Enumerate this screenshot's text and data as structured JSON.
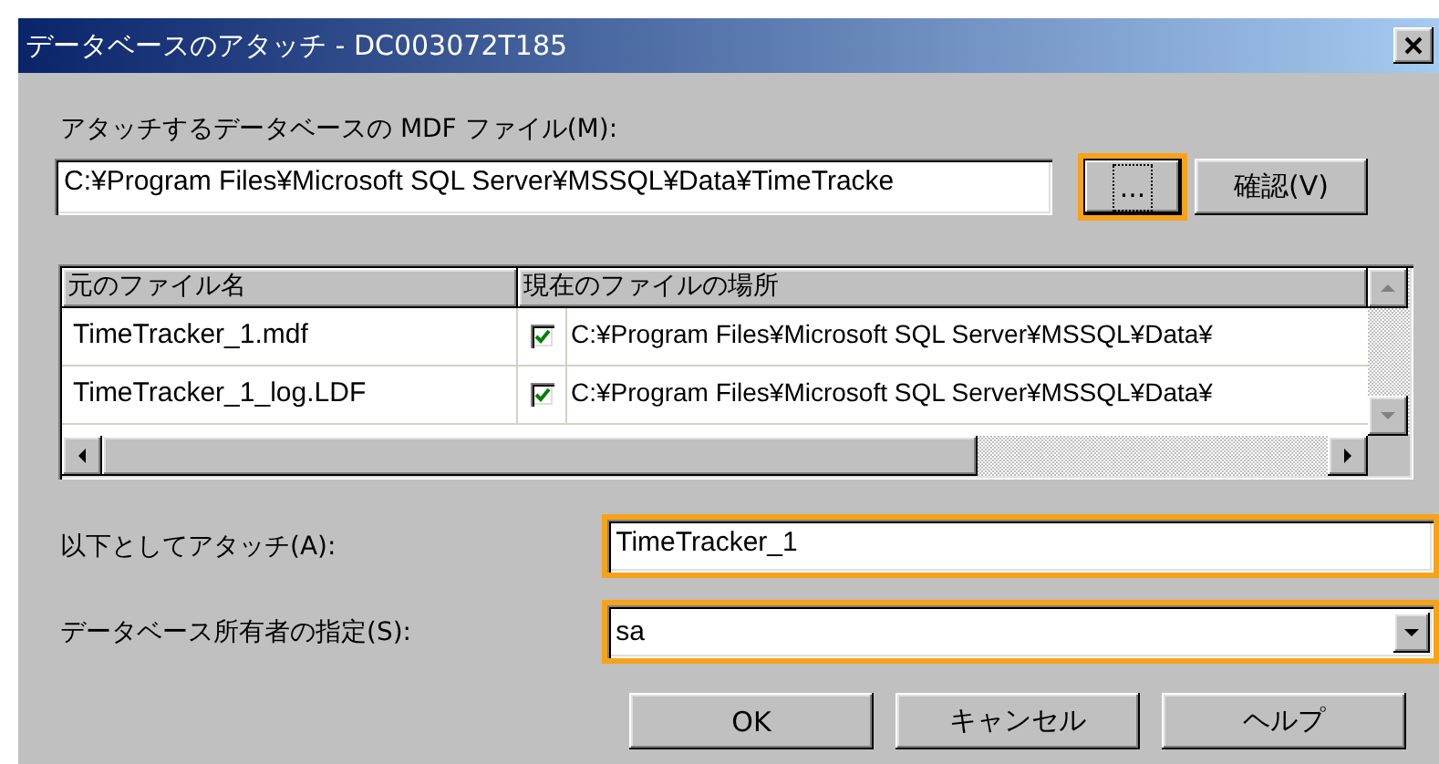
{
  "window": {
    "title": "データベースのアタッチ - DC003072T185"
  },
  "mdf_file": {
    "label": "アタッチするデータベースの MDF ファイル(M):",
    "value": "C:¥Program Files¥Microsoft SQL Server¥MSSQL¥Data¥TimeTracke",
    "buttons": [
      {
        "label": "...",
        "focused": true,
        "highlighted": true
      },
      {
        "label": "確認(V)",
        "focused": false,
        "highlighted": false
      }
    ]
  },
  "files_table": {
    "columns": [
      "元のファイル名",
      "現在のファイルの場所"
    ],
    "rows": [
      {
        "original_name": "TimeTracker_1.mdf",
        "found": true,
        "current_location": "C:¥Program Files¥Microsoft SQL Server¥MSSQL¥Data¥"
      },
      {
        "original_name": "TimeTracker_1_log.LDF",
        "found": true,
        "current_location": "C:¥Program Files¥Microsoft SQL Server¥MSSQL¥Data¥"
      }
    ]
  },
  "attach_as": {
    "label": "以下としてアタッチ(A):",
    "value": "TimeTracker_1",
    "highlighted": true
  },
  "owner": {
    "label": "データベース所有者の指定(S):",
    "value": "sa",
    "highlighted": true
  },
  "buttons": [
    {
      "label": "OK"
    },
    {
      "label": "キャンセル"
    },
    {
      "label": "ヘルプ"
    }
  ]
}
